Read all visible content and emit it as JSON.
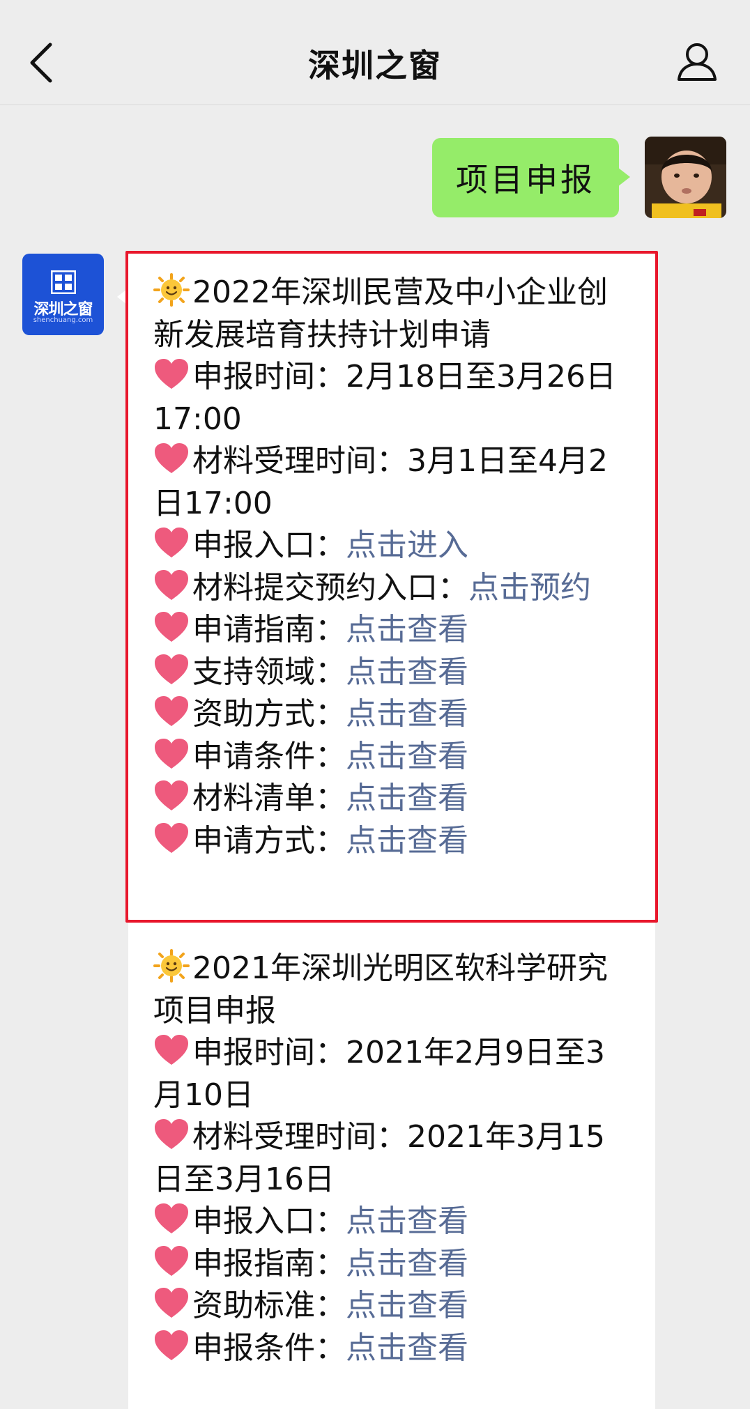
{
  "header": {
    "title": "深圳之窗"
  },
  "me_message": {
    "text": "项目申报"
  },
  "bot": {
    "brand": "深圳之窗",
    "url": "shenchuang.com"
  },
  "card1": {
    "heading": "2022年深圳民营及中小企业创新发展培育扶持计划申请",
    "items": [
      {
        "label": "申报时间：2月18日至3月26日17:00",
        "link": ""
      },
      {
        "label": "材料受理时间：3月1日至4月2日17:00",
        "link": ""
      },
      {
        "label": "申报入口：",
        "link": "点击进入"
      },
      {
        "label": "材料提交预约入口：",
        "link": "点击预约"
      },
      {
        "label": "申请指南：",
        "link": "点击查看"
      },
      {
        "label": "支持领域：",
        "link": "点击查看"
      },
      {
        "label": "资助方式：",
        "link": "点击查看"
      },
      {
        "label": "申请条件：",
        "link": "点击查看"
      },
      {
        "label": "材料清单：",
        "link": "点击查看"
      },
      {
        "label": "申请方式：",
        "link": "点击查看"
      }
    ]
  },
  "card2": {
    "heading": "2021年深圳光明区软科学研究项目申报",
    "items": [
      {
        "label": "申报时间：2021年2月9日至3月10日",
        "link": ""
      },
      {
        "label": "材料受理时间：2021年3月15日至3月16日",
        "link": ""
      },
      {
        "label": "申报入口：",
        "link": "点击查看"
      },
      {
        "label": "申报指南：",
        "link": "点击查看"
      },
      {
        "label": "资助标准：",
        "link": "点击查看"
      },
      {
        "label": "申报条件：",
        "link": "点击查看"
      }
    ]
  },
  "colors": {
    "link": "#576b95",
    "highlight_border": "#e8172c",
    "me_bubble": "#95ec69",
    "bot_avatar": "#1d52d6"
  },
  "icons": {
    "back": "chevron-left-icon",
    "profile": "person-icon",
    "heading": "sun-emoji-icon",
    "bullet": "heart-emoji-icon"
  }
}
